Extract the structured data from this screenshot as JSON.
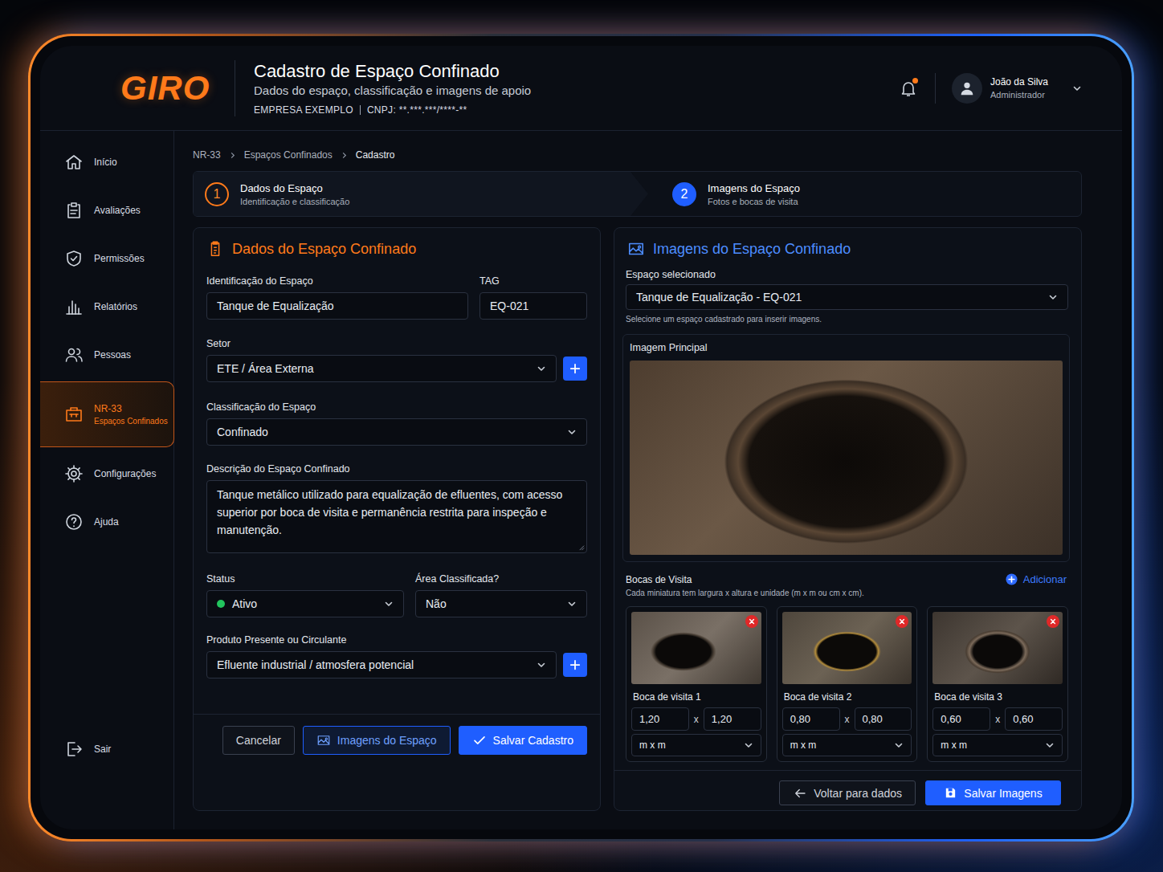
{
  "header": {
    "logo": "GIRO",
    "title": "Cadastro de Espaço Confinado",
    "subtitle": "Dados do espaço, classificação e imagens de apoio",
    "company": "EMPRESA EXEMPLO",
    "cnpj": "CNPJ: **.***.***/****-**",
    "notifications_unread": true,
    "user": {
      "name": "João da Silva",
      "role": "Administrador"
    }
  },
  "sidebar": {
    "items": [
      {
        "label": "Início",
        "sub": "",
        "selected": false
      },
      {
        "label": "Avaliações",
        "sub": "",
        "selected": false
      },
      {
        "label": "Permissões",
        "sub": "",
        "selected": false
      },
      {
        "label": "Relatórios",
        "sub": "",
        "selected": false
      },
      {
        "label": "Pessoas",
        "sub": "",
        "selected": false
      },
      {
        "label": "NR-33",
        "sub": "Espaços Confinados",
        "selected": true
      },
      {
        "label": "Configurações",
        "sub": "",
        "selected": false
      },
      {
        "label": "Ajuda",
        "sub": "",
        "selected": false
      }
    ],
    "logout": "Sair"
  },
  "breadcrumb": [
    "NR-33",
    "Espaços Confinados",
    "Cadastro"
  ],
  "steps": [
    {
      "number": "1",
      "title": "Dados do Espaço",
      "subtitle": "Identificação e classificação",
      "selected": true
    },
    {
      "number": "2",
      "title": "Imagens do Espaço",
      "subtitle": "Fotos e bocas de visita",
      "selected": false
    }
  ],
  "data_panel": {
    "title": "Dados do Espaço Confinado",
    "identification": {
      "label": "Identificação do Espaço",
      "value": "Tanque de Equalização"
    },
    "tag": {
      "label": "TAG",
      "value": "EQ-021"
    },
    "sector": {
      "label": "Setor",
      "value": "ETE / Área Externa"
    },
    "classification": {
      "label": "Classificação do Espaço",
      "value": "Confinado"
    },
    "description": {
      "label": "Descrição do Espaço Confinado",
      "value": "Tanque metálico utilizado para equalização de efluentes, com acesso superior por boca de visita e permanência restrita para inspeção e manutenção."
    },
    "status": {
      "label": "Status",
      "value": "Ativo",
      "color": "#22c55e"
    },
    "classified_area": {
      "label": "Área Classificada?",
      "value": "Não"
    },
    "product": {
      "label": "Produto Presente ou Circulante",
      "value": "Efluente industrial / atmosfera potencial"
    },
    "buttons": {
      "cancel": "Cancelar",
      "images": "Imagens do Espaço",
      "save": "Salvar Cadastro"
    }
  },
  "images_panel": {
    "title": "Imagens do Espaço Confinado",
    "selected_space": {
      "label": "Espaço selecionado",
      "value": "Tanque de Equalização - EQ-021",
      "hint": "Selecione um espaço cadastrado para inserir imagens."
    },
    "main_image": {
      "label": "Imagem Principal"
    },
    "manholes": {
      "title": "Bocas de Visita",
      "add": "Adicionar",
      "hint": "Cada miniatura tem largura x altura e unidade (m x m ou cm x cm).",
      "items": [
        {
          "name": "Boca de visita 1",
          "width": "1,20",
          "separator": "x",
          "height": "1,20",
          "unit": "m x m"
        },
        {
          "name": "Boca de visita 2",
          "width": "0,80",
          "separator": "x",
          "height": "0,80",
          "unit": "m x m"
        },
        {
          "name": "Boca de visita 3",
          "width": "0,60",
          "separator": "x",
          "height": "0,60",
          "unit": "m x m"
        }
      ]
    },
    "buttons": {
      "back": "Voltar para dados",
      "save": "Salvar Imagens"
    }
  }
}
